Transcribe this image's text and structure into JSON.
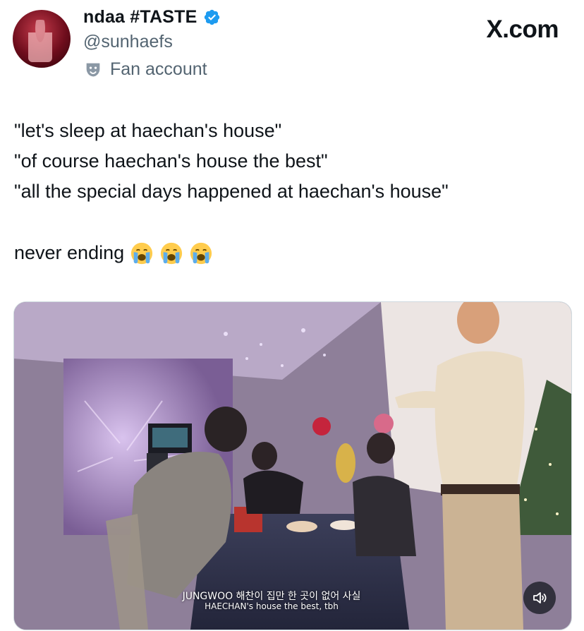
{
  "header": {
    "display_name": "ndaa #TASTE",
    "handle": "@sunhaefs",
    "account_label": "Fan account",
    "brand": "X.com"
  },
  "tweet": {
    "lines": [
      "\"let's sleep at haechan's house\"",
      "\"of course haechan's house the best\"",
      "\"all the special days happened at haechan's house\"",
      "never ending"
    ],
    "emoji_count": 3
  },
  "media": {
    "subtitle_korean": "JUNGWOO  해찬이 집만 한 곳이 없어 사실",
    "subtitle_english": "HAECHAN's house the best, tbh"
  },
  "colors": {
    "verified": "#1d9bf0",
    "secondary_text": "#536471",
    "primary_text": "#0f1419"
  },
  "icons": {
    "verified": "verified-badge-icon",
    "label": "theater-mask-icon",
    "emoji": "loudly-crying-face-icon",
    "sound": "speaker-icon"
  }
}
